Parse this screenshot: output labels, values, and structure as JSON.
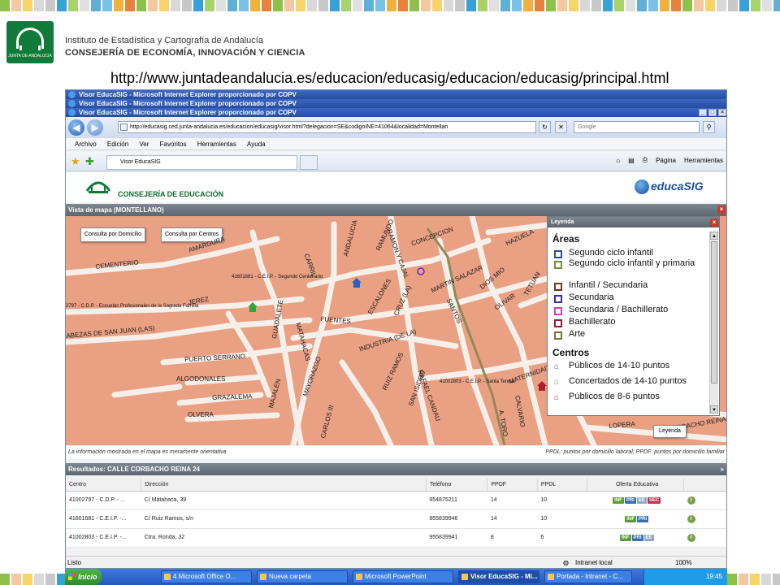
{
  "slide": {
    "institute_line1": "Instituto de Estadística y Cartografía de Andalucía",
    "institute_line2": "CONSEJERÍA DE ECONOMÍA, INNOVACIÓN Y CIENCIA",
    "crest_label": "JUNTA DE ANDALUCIA",
    "url": "http://www.juntadeandalucia.es/educacion/educasig/educacion/educasig/principal.html"
  },
  "browser": {
    "title": "Visor EducaSIG - Microsoft Internet Explorer proporcionado por COPV",
    "address": "http://educasig.ced.junta-andalucia.es/educacion/educasig/visor.html?delegacion=SE&codigoINE=41064&localidad=Montellan",
    "search_placeholder": "Google",
    "menu": [
      "Archivo",
      "Edición",
      "Ver",
      "Favoritos",
      "Herramientas",
      "Ayuda"
    ],
    "tab_label": "Visor EducaSIG",
    "tools": [
      "Página",
      "Herramientas"
    ],
    "status_left": "Listo",
    "status_zone": "Intranet local",
    "zoom": "100%"
  },
  "page": {
    "consejeria": "CONSEJERÍA DE EDUCACIÓN",
    "educasig_logo": "educaSIG",
    "map_title": "Vista de mapa (MONTELLANO)",
    "btn_domicilio": "Consulta por Domicilio",
    "btn_centros": "Consulta por Centros",
    "disclaimer": "La información mostrada en el mapa es meramente orientativa",
    "ppdl_note": "PPDL: puntos por domicilio laboral; PPDF: puntos por domicilio familiar",
    "legend_button": "Leyenda"
  },
  "map": {
    "streets": [
      "CEMENTERIO",
      "AMARGURA",
      "JEREZ",
      "ABEZAS DE SAN JUAN (LAS)",
      "PUERTO SERRANO",
      "ALGODONALES",
      "GRAZALEMA",
      "OLVERA",
      "MAJALEN",
      "MAYORAZGO",
      "CARLOS III",
      "FUENTES",
      "GUADALETE",
      "MATAHACAS",
      "CARRIL",
      "ANDALUCIA",
      "RAMUNDO",
      "CONCEPCION",
      "RAMON Y CAJAL",
      "ESCALONES",
      "CRUZ (LA)",
      "INDUSTRIA (DE LA)",
      "RUIZ RAMOS",
      "SAN ISIDRO",
      "RAFAEL CANDAU",
      "MARTIN SALAZAR",
      "SANTOS",
      "DIOS MIO",
      "OLIVAR",
      "HAZUELA",
      "TETUAN",
      "LOPERA",
      "CORBACHO REINA",
      "MATERNIDAD",
      "CALVARIO",
      "A. TORO"
    ],
    "pois": [
      "41601681 - C.E.I.P. - Segundo Centenario",
      "2797 - C.D.P. - Escuelas Profesionales de la Sagrada Familia",
      "41002803 - C.E.I.P. - Santa Teresa"
    ]
  },
  "legend": {
    "title": "Leyenda",
    "areas_title": "Áreas",
    "areas": [
      {
        "label": "Segundo ciclo infantil",
        "color": "#2f4f8f"
      },
      {
        "label": "Segundo ciclo infantil y primaria",
        "color": "#6f8f3a"
      },
      {
        "label": "Infantil / Secundaria",
        "color": "#6b3a1a"
      },
      {
        "label": "Secundaria",
        "color": "#3b2f8f"
      },
      {
        "label": "Secundaria / Bachillerato",
        "color": "#d23fb8"
      },
      {
        "label": "Bachillerato",
        "color": "#8a1f3a"
      },
      {
        "label": "Arte",
        "color": "#7a6f3a"
      }
    ],
    "centros_title": "Centros",
    "centros": [
      {
        "label": "Públicos de 14-10 puntos",
        "color": "#2e5fbf"
      },
      {
        "label": "Concertados de 14-10 puntos",
        "color": "#2fa62f"
      },
      {
        "label": "Públicos de 8-6 puntos",
        "color": "#b01c2a"
      }
    ]
  },
  "results": {
    "title": "Resultados: CALLE CORBACHO REINA 24",
    "columns": [
      "Centro",
      "Dirección",
      "Teléfono",
      "PPDF",
      "PPDL",
      "Oferta Educativa"
    ],
    "rows": [
      {
        "centro": "41002797 - C.D.P. - ...",
        "direccion": "C/ Matahaca, 39",
        "telefono": "954875211",
        "ppdf": "14",
        "ppdl": "10",
        "oferta": [
          "INF",
          "PRI",
          "EE",
          "SEC"
        ]
      },
      {
        "centro": "41601681 - C.E.I.P. -...",
        "direccion": "C/ Ruiz Ramos, s/n",
        "telefono": "955839946",
        "ppdf": "14",
        "ppdl": "10",
        "oferta": [
          "INF",
          "PRI"
        ]
      },
      {
        "centro": "41002803 - C.E.I.P. -...",
        "direccion": "Ctra. Ronda, 32",
        "telefono": "955839941",
        "ppdf": "8",
        "ppdl": "6",
        "oferta": [
          "INF",
          "PRI",
          "EE"
        ]
      }
    ],
    "badge_colors": {
      "INF": "#5c9a3a",
      "PRI": "#3a6fb0",
      "EE": "#8fa8c8",
      "SEC": "#c0304a"
    }
  },
  "taskbar": {
    "start": "Inicio",
    "items": [
      {
        "label": "4 Microsoft Office O...",
        "active": false
      },
      {
        "label": "Nueva carpeta",
        "active": false
      },
      {
        "label": "Microsoft PowerPoint",
        "active": false
      },
      {
        "label": "Visor EducaSIG - Mi...",
        "active": true
      },
      {
        "label": "Portada - Intranet - C...",
        "active": false
      }
    ],
    "clock": "19:45"
  }
}
